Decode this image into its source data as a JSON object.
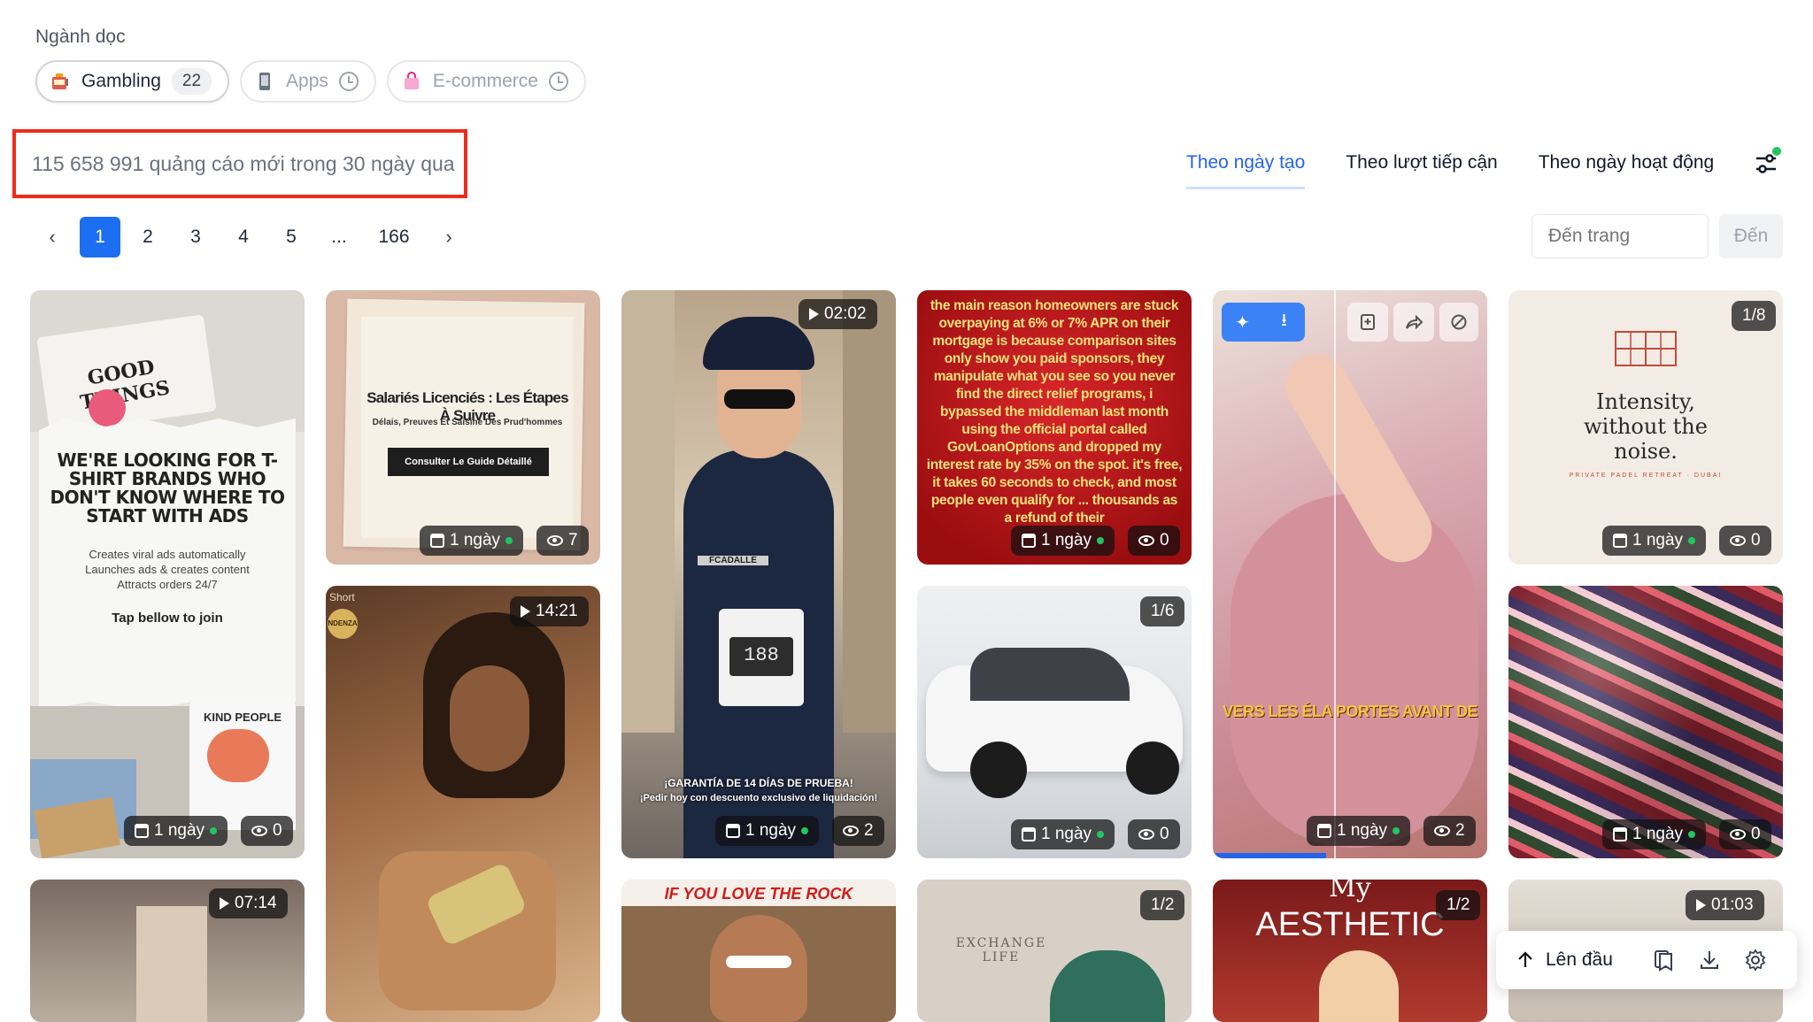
{
  "vertical": {
    "label": "Ngành dọc",
    "chips": [
      {
        "name": "Gambling",
        "count": "22",
        "icon": "slot-machine-icon"
      },
      {
        "name": "Apps",
        "icon": "phone-icon"
      },
      {
        "name": "E-commerce",
        "icon": "shopping-bag-icon"
      }
    ]
  },
  "summary": {
    "text": "115 658 991 quảng cáo mới trong 30 ngày qua"
  },
  "sort": {
    "tabs": [
      "Theo ngày tạo",
      "Theo lượt tiếp cận",
      "Theo ngày hoạt động"
    ],
    "active": 0
  },
  "pagination": {
    "pages": [
      "1",
      "2",
      "3",
      "4",
      "5",
      "...",
      "166"
    ],
    "current": "1"
  },
  "goto": {
    "placeholder": "Đến trang",
    "button": "Đến"
  },
  "cards": [
    {
      "age": "1 ngày",
      "views": "0",
      "headline": "WE'RE LOOKING FOR T-SHIRT BRANDS WHO DON'T KNOW WHERE TO START WITH ADS",
      "body": "Creates viral ads automatically\nLaunches ads & creates content\nAttracts orders 24/7",
      "cta": "Tap bellow to join",
      "tee1": "GOOD THINGS",
      "tee2": "KIND PEOPLE"
    },
    {
      "age": "1 ngày",
      "views": "7",
      "headline": "Salariés Licenciés : Les Étapes À Suivre",
      "sub": "Délais, Preuves Et Saisine Des Prud'hommes",
      "cta": "Consulter Le Guide Détaillé"
    },
    {
      "duration": "14:21",
      "caption": "Short",
      "logo": "NDENZA"
    },
    {
      "duration": "02:02",
      "age": "1 ngày",
      "views": "2",
      "badge": "FCADALLE",
      "device": "188",
      "promo1": "¡GARANTÍA DE 14 DÍAS DE PRUEBA!",
      "promo2": "¡Pedir hoy con descuento exclusivo de liquidación!"
    },
    {
      "headline": "IF YOU LOVE THE ROCK"
    },
    {
      "age": "1 ngày",
      "views": "0",
      "text": "the main reason homeowners are stuck overpaying at 6% or 7% APR on their mortgage is because comparison sites only show you paid sponsors, they manipulate what you see so you never find the direct relief programs, i bypassed the middleman last month using the official portal called GovLoanOptions and dropped my interest rate by 35% on the spot. it's free, it takes 60 seconds to check, and most people even qualify for ... thousands as a refund of their"
    },
    {
      "counter": "1/6",
      "age": "1 ngày",
      "views": "0"
    },
    {
      "counter": "1/2",
      "brand": "EXCHANGE LIFE"
    },
    {
      "age": "1 ngày",
      "views": "2",
      "caption": "VERS LES ÉLA PORTES AVANT DE"
    },
    {
      "counter": "1/2",
      "title1": "My",
      "title2": "AESTHETIC"
    },
    {
      "counter": "1/8",
      "age": "1 ngày",
      "views": "0",
      "headline": "Intensity, without the noise.",
      "sub": "PRIVATE PADEL RETREAT · DUBAI"
    },
    {
      "age": "1 ngày",
      "views": "0"
    },
    {
      "duration": "07:14"
    },
    {
      "duration": "01:03"
    }
  ],
  "floatbar": {
    "top": "Lên đầu"
  }
}
